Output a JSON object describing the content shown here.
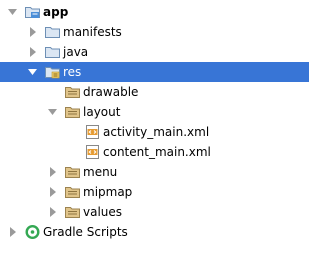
{
  "colors": {
    "selection": "#3875d6",
    "folder_stroke": "#6d8fb5",
    "folder_fill": "#dbe6f3",
    "module_accent": "#4c8fd8",
    "res_fill": "#f0cd6e",
    "res_folder_fill": "#e0c48a",
    "layout_xml": "#e59b33",
    "arrow": "#9a9a9a",
    "gradle": "#34a853"
  },
  "tree": [
    {
      "name": "tree-item-app",
      "label": "app",
      "arrow": "expanded",
      "icon": "module-folder-icon",
      "bold": true,
      "selected": false
    },
    {
      "name": "tree-item-manifests",
      "label": "manifests",
      "arrow": "collapsed",
      "icon": "folder-icon",
      "bold": false,
      "selected": false
    },
    {
      "name": "tree-item-java",
      "label": "java",
      "arrow": "collapsed",
      "icon": "folder-icon",
      "bold": false,
      "selected": false
    },
    {
      "name": "tree-item-res",
      "label": "res",
      "arrow": "expanded",
      "icon": "resources-folder-icon",
      "bold": false,
      "selected": true
    },
    {
      "name": "tree-item-drawable",
      "label": "drawable",
      "arrow": "none",
      "icon": "res-folder-icon",
      "bold": false,
      "selected": false
    },
    {
      "name": "tree-item-layout",
      "label": "layout",
      "arrow": "expanded",
      "icon": "res-folder-icon",
      "bold": false,
      "selected": false
    },
    {
      "name": "tree-item-activity-main",
      "label": "activity_main.xml",
      "arrow": "none",
      "icon": "layout-xml-icon",
      "bold": false,
      "selected": false
    },
    {
      "name": "tree-item-content-main",
      "label": "content_main.xml",
      "arrow": "none",
      "icon": "layout-xml-icon",
      "bold": false,
      "selected": false
    },
    {
      "name": "tree-item-menu",
      "label": "menu",
      "arrow": "collapsed",
      "icon": "res-folder-icon",
      "bold": false,
      "selected": false
    },
    {
      "name": "tree-item-mipmap",
      "label": "mipmap",
      "arrow": "collapsed",
      "icon": "res-folder-icon",
      "bold": false,
      "selected": false
    },
    {
      "name": "tree-item-values",
      "label": "values",
      "arrow": "collapsed",
      "icon": "res-folder-icon",
      "bold": false,
      "selected": false
    },
    {
      "name": "tree-item-gradle-scripts",
      "label": "Gradle Scripts",
      "arrow": "collapsed",
      "icon": "gradle-icon",
      "bold": false,
      "selected": false
    }
  ]
}
